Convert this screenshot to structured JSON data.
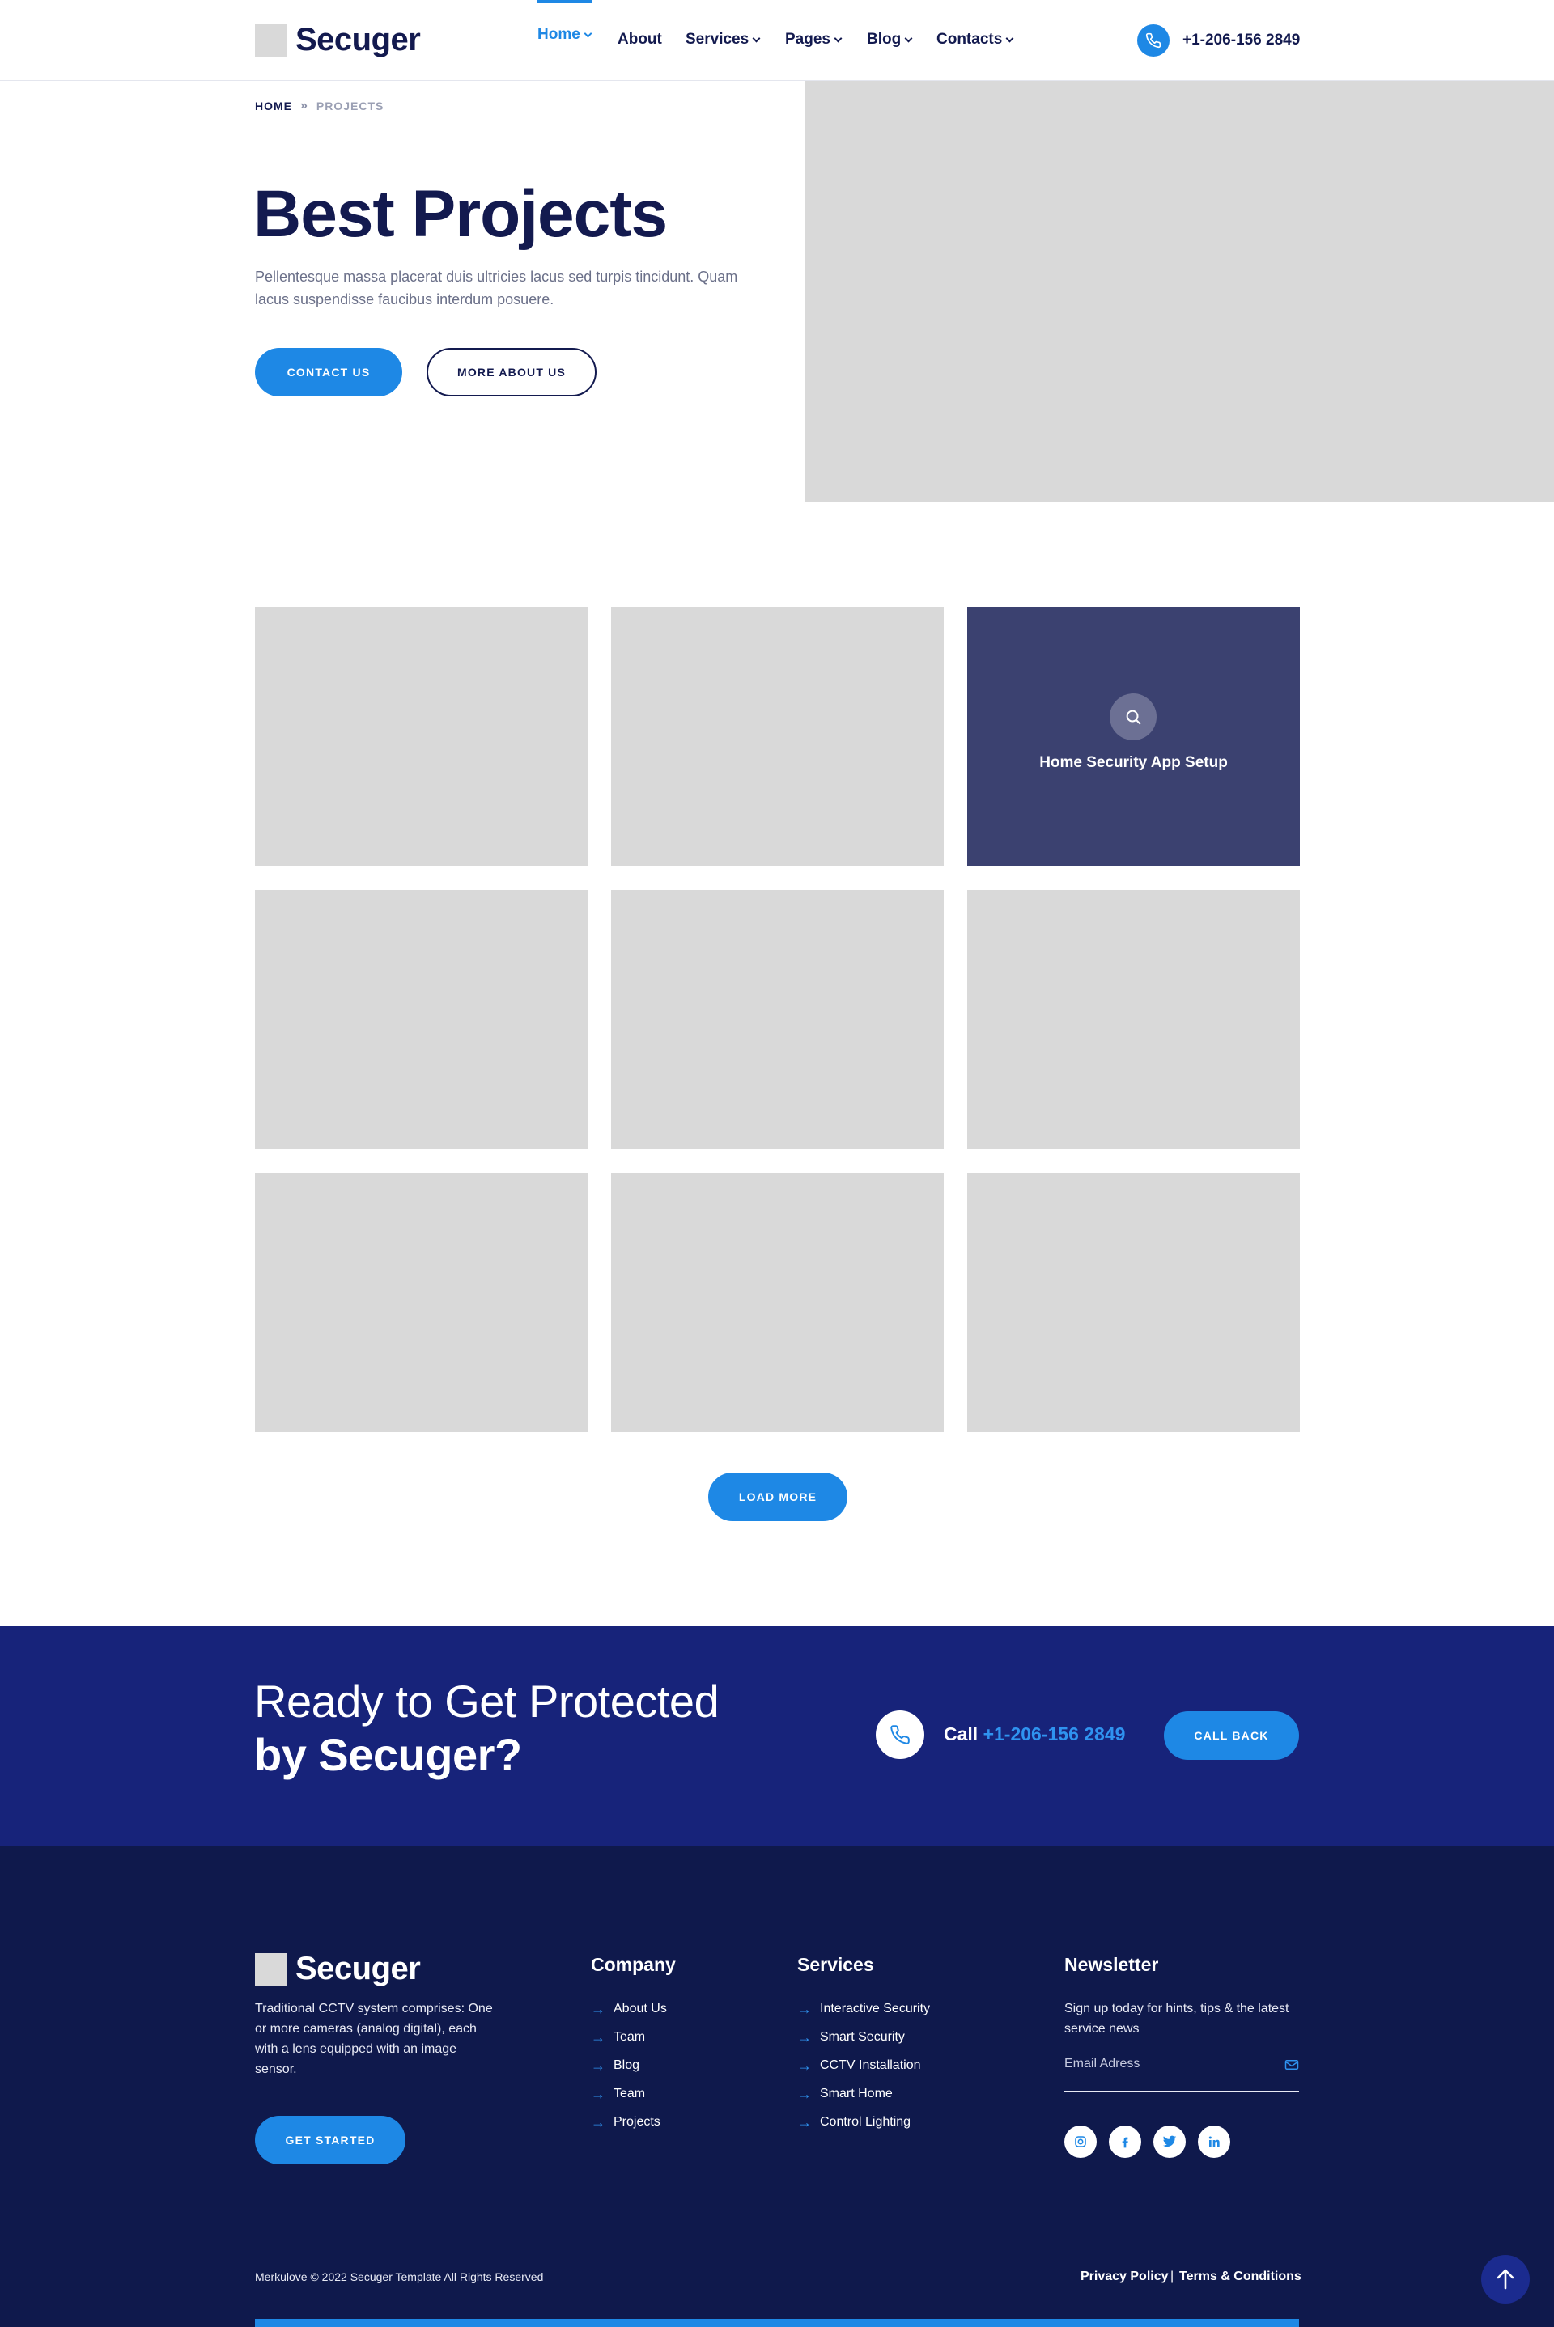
{
  "brand": {
    "name": "Secuger"
  },
  "nav": {
    "items": [
      {
        "label": "Home",
        "active": true
      },
      {
        "label": "About"
      },
      {
        "label": "Services"
      },
      {
        "label": "Pages"
      },
      {
        "label": "Blog"
      },
      {
        "label": "Contacts"
      }
    ],
    "phone": "+1-206-156 2849"
  },
  "breadcrumb": {
    "home": "HOME",
    "current": "PROJECTS"
  },
  "hero": {
    "title": "Best Projects",
    "text": "Pellentesque massa placerat duis ultricies lacus sed turpis tincidunt. Quam lacus suspendisse faucibus interdum posuere.",
    "primary_button": "CONTACT US",
    "secondary_button": "MORE ABOUT US"
  },
  "projects": {
    "hover_title": "Home Security App Setup",
    "load_more": "LOAD MORE"
  },
  "cta": {
    "line1": "Ready to Get Protected",
    "line2": "by Secuger?",
    "call_prefix": "Call",
    "call_number": "+1-206-156 2849",
    "button": "CALL BACK"
  },
  "footer": {
    "about": "Traditional CCTV system comprises: One or more cameras (analog digital), each with a lens equipped with an image sensor.",
    "get_started": "GET STARTED",
    "company": {
      "heading": "Company",
      "links": [
        "About Us",
        "Team",
        "Blog",
        "Team",
        "Projects"
      ]
    },
    "services": {
      "heading": "Services",
      "links": [
        "Interactive Security",
        "Smart Security",
        "CCTV Installation",
        "Smart Home",
        "Control Lighting"
      ]
    },
    "newsletter": {
      "heading": "Newsletter",
      "text": "Sign up today for hints, tips & the latest service news",
      "placeholder": "Email Adress"
    },
    "social": [
      "instagram-icon",
      "facebook-icon",
      "twitter-icon",
      "linkedin-icon"
    ],
    "copyright": "Merkulove © 2022 Secuger Template All Rights Reserved",
    "privacy": "Privacy Policy",
    "separator": "|",
    "terms": "Terms & Conditions"
  },
  "colors": {
    "accent": "#1e88e5",
    "navy": "#131a4f",
    "cta_bg": "#17237a",
    "footer_bg": "#0f194c",
    "placeholder": "#d9d9d9",
    "card_overlay": "#3b4170"
  }
}
